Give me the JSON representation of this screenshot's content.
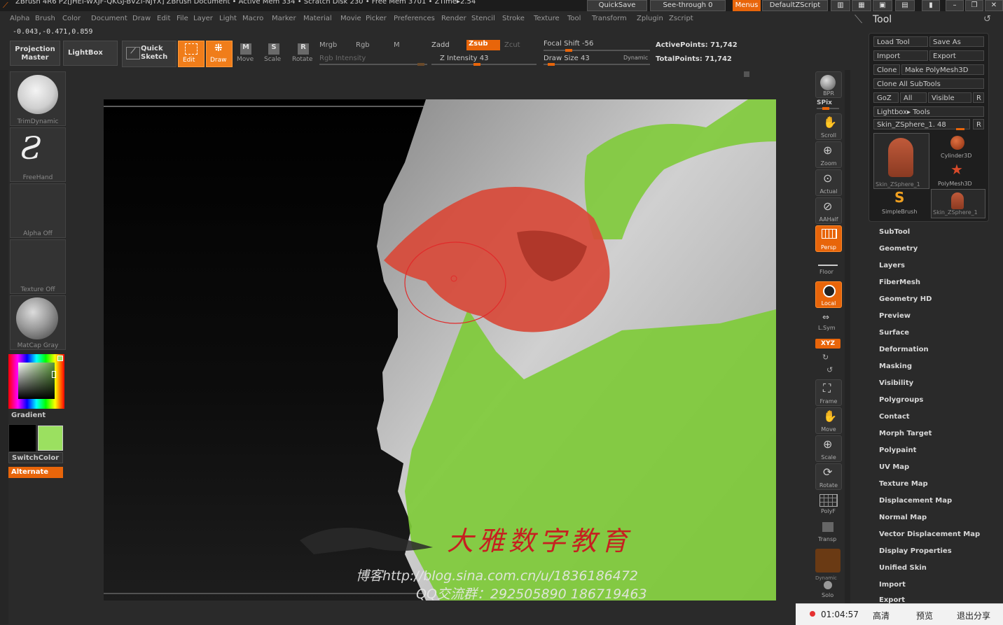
{
  "titlebar": {
    "title": "ZBrush 4R6 P2[JHEI-WXJF-QKGJ-BVZI-NJYX]   ZBrush Document   • Active Mem 334 • Scratch Disk 230 • Free Mem 3701 • ZTime▸2.54",
    "quicksave": "QuickSave",
    "see_through": "See-through  0",
    "menus": "Menus",
    "default_zscript": "DefaultZScript"
  },
  "menubar": [
    "Alpha",
    "Brush",
    "Color",
    "Document",
    "Draw",
    "Edit",
    "File",
    "Layer",
    "Light",
    "Macro",
    "Marker",
    "Material",
    "Movie",
    "Picker",
    "Preferences",
    "Render",
    "Stencil",
    "Stroke",
    "Texture",
    "Tool",
    "Transform",
    "Zplugin",
    "Zscript"
  ],
  "coords": "-0.043,-0.471,0.859",
  "shelf": {
    "projection_master": "Projection Master",
    "lightbox": "LightBox",
    "quick_sketch": "Quick Sketch",
    "edit": "Edit",
    "draw": "Draw",
    "move": "Move",
    "scale": "Scale",
    "rotate": "Rotate",
    "mrgb": "Mrgb",
    "rgb": "Rgb",
    "m": "M",
    "zadd": "Zadd",
    "zsub": "Zsub",
    "zcut": "Zcut",
    "rgb_intensity": "Rgb Intensity",
    "z_intensity": "Z Intensity 43",
    "z_intensity_value": 43,
    "focal_shift": "Focal Shift -56",
    "focal_shift_value": -56,
    "draw_size": "Draw Size 43",
    "draw_size_value": 43,
    "dynamic": "Dynamic",
    "active_points": "ActivePoints: 71,742",
    "total_points": "TotalPoints: 71,742"
  },
  "lefttray": {
    "brush": "TrimDynamic",
    "stroke": "FreeHand",
    "alpha": "Alpha  Off",
    "texture": "Texture  Off",
    "material": "MatCap  Gray",
    "gradient": "Gradient",
    "switchcolor": "SwitchColor",
    "alternate": "Alternate",
    "secondary_color": "#9be060"
  },
  "righttools": {
    "bpr": "BPR",
    "spix": "SPix",
    "scroll": "Scroll",
    "zoom": "Zoom",
    "actual": "Actual",
    "aahalf": "AAHalf",
    "persp": "Persp",
    "floor": "Floor",
    "local": "Local",
    "lsym": "L.Sym",
    "xyz": "XYZ",
    "frame": "Frame",
    "move": "Move",
    "scale": "Scale",
    "rotate": "Rotate",
    "polyf": "PolyF",
    "transp": "Transp",
    "dynamic": "Dynamic",
    "solo": "Solo"
  },
  "toolpanel": {
    "title": "Tool",
    "load_tool": "Load Tool",
    "save_as": "Save As",
    "import": "Import",
    "export": "Export",
    "clone": "Clone",
    "make_polymesh": "Make PolyMesh3D",
    "clone_all": "Clone  All  SubTools",
    "goz": "GoZ",
    "all": "All",
    "visible": "Visible",
    "r": "R",
    "lightbox_tools": "Lightbox▸ Tools",
    "current_tool": "Skin_ZSphere_1. 48",
    "thumbs": [
      "Skin_ZSphere_1",
      "Cylinder3D",
      "PolyMesh3D",
      "SimpleBrush",
      "Skin_ZSphere_1"
    ]
  },
  "toolmenu": [
    "SubTool",
    "Geometry",
    "Layers",
    "FiberMesh",
    "Geometry HD",
    "Preview",
    "Surface",
    "Deformation",
    "Masking",
    "Visibility",
    "Polygroups",
    "Contact",
    "Morph Target",
    "Polypaint",
    "UV Map",
    "Texture Map",
    "Displacement Map",
    "Normal Map",
    "Vector Displacement Map",
    "Display Properties",
    "Unified Skin",
    "Import",
    "Export"
  ],
  "watermark": {
    "logo_text": "大雅数字教育",
    "blog": "博客http://blog.sina.com.cn/u/1836186472",
    "qq": "QQ交流群：292505890  186719463"
  },
  "bottombar": {
    "timer": "01:04:57",
    "hd": "高清",
    "preview": "预览",
    "exit": "退出分享"
  }
}
